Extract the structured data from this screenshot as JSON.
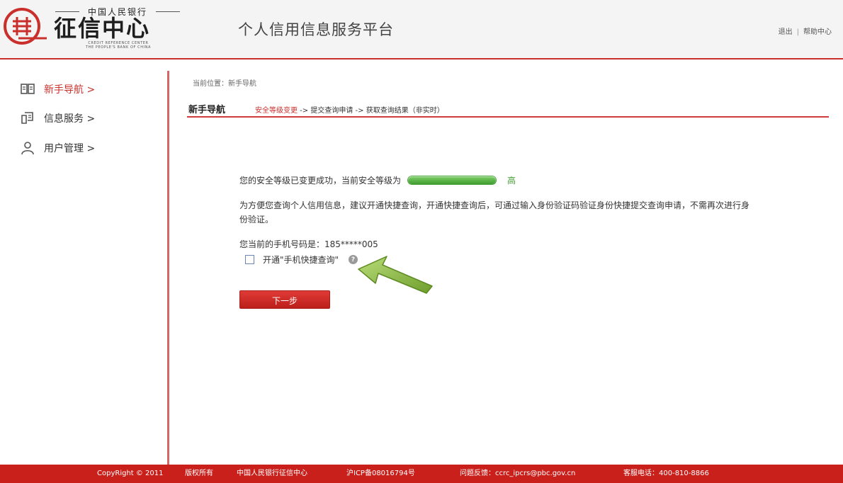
{
  "header": {
    "logo_top": "中国人民银行",
    "logo_main": "征信中心",
    "logo_en_line1": "CREDIT REFERENCE CENTER",
    "logo_en_line2": "THE PEOPLE'S BANK OF CHINA",
    "platform_title": "个人信用信息服务平台",
    "links": {
      "logout": "退出",
      "separator": "|",
      "help": "帮助中心"
    }
  },
  "sidebar": {
    "items": [
      {
        "label": "新手导航 >",
        "icon": "book-icon",
        "active": true
      },
      {
        "label": "信息服务 >",
        "icon": "document-icon",
        "active": false
      },
      {
        "label": "用户管理 >",
        "icon": "user-icon",
        "active": false
      }
    ]
  },
  "main": {
    "breadcrumb": "当前位置：新手导航",
    "section_title": "新手导航",
    "steps": {
      "current": "安全等级变更",
      "rest": " -> 提交查询申请 -> 获取查询结果（非实时）"
    },
    "level_message": "您的安全等级已变更成功，当前安全等级为",
    "level_text": "高",
    "level_fraction": 1.0,
    "tip": "为方便您查询个人信用信息，建议开通快捷查询，开通快捷查询后，可通过输入身份验证码验证身份快捷提交查询申请，不需再次进行身份验证。",
    "phone_line": "您当前的手机号码是：185*****005",
    "quick_query_label": "开通\"手机快捷查询\"",
    "help_glyph": "?",
    "next_button": "下一步"
  },
  "footer": {
    "copyright": "CopyRight © 2011",
    "rights": "版权所有",
    "org": "中国人民银行征信中心",
    "icp": "沪ICP备08016794号",
    "feedback": "问题反馈：ccrc_ipcrs@pbc.gov.cn",
    "hotline": "客服电话：400-810-8866"
  },
  "colors": {
    "brand_red": "#c9201c",
    "level_green": "#3f9d2f",
    "arrow_green": "#8fbe4a"
  }
}
